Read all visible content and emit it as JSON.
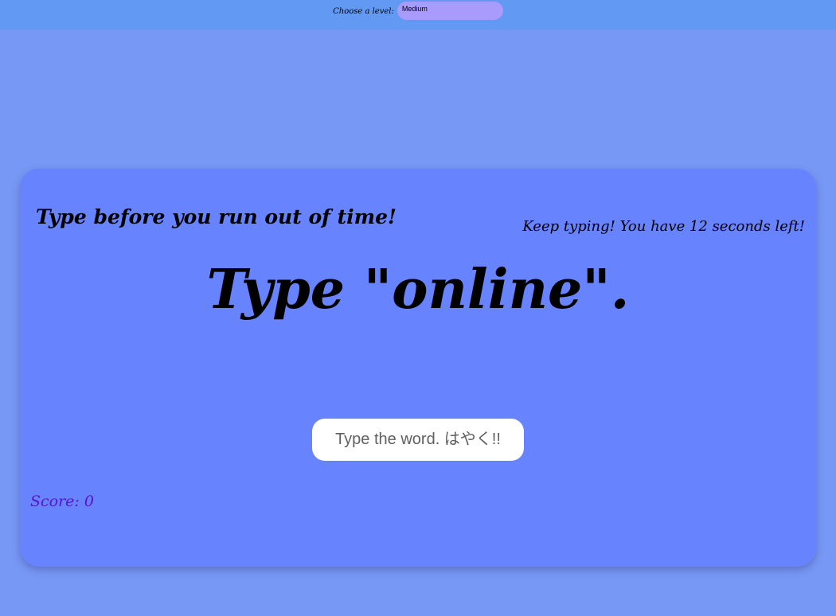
{
  "level": {
    "label": "Choose a level:",
    "selected": "Medium"
  },
  "game": {
    "subtitle": "Type before you run out of time!",
    "timer_text": "Keep typing! You have 12 seconds left!",
    "prompt": "Type \"online\".",
    "input_placeholder": "Type the word. はやく!!",
    "score_text": "Score: 0"
  },
  "colors": {
    "page_bg": "#7898f5",
    "topbar_bg": "#6299f2",
    "card_bg": "#6883fe",
    "select_bg": "#a99bfc",
    "score_color": "#5a12ce"
  }
}
